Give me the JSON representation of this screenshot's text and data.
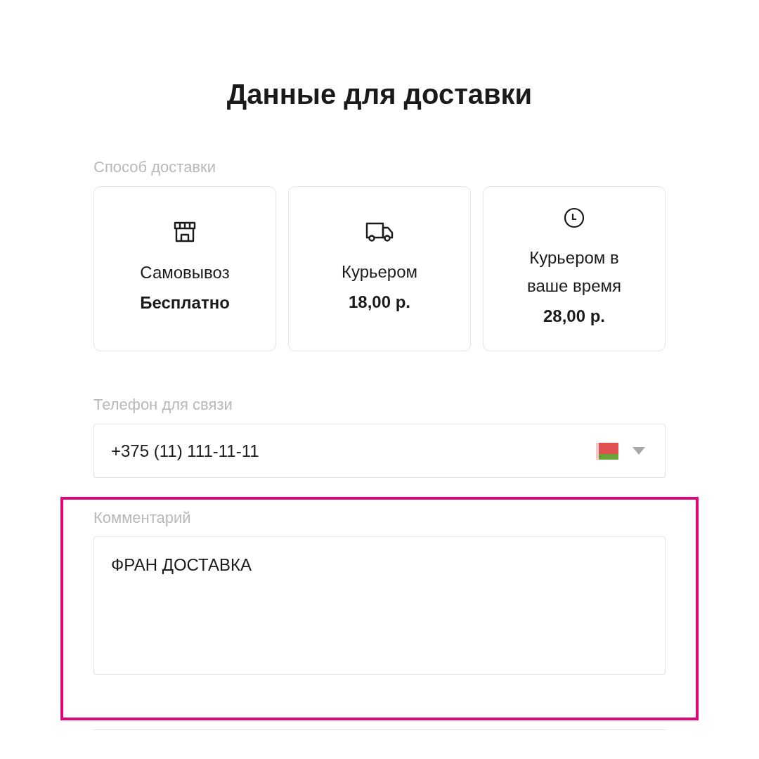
{
  "title": "Данные для доставки",
  "delivery": {
    "label": "Способ доставки",
    "options": [
      {
        "kind": "pickup",
        "name": "Самовывоз",
        "price": "Бесплатно"
      },
      {
        "kind": "courier",
        "name": "Курьером",
        "price": "18,00 р."
      },
      {
        "kind": "scheduled",
        "name": "Курьером в ваше время",
        "price": "28,00 р."
      }
    ]
  },
  "phone": {
    "label": "Телефон для связи",
    "value": "+375 (11) 111-11-11",
    "flag": {
      "kind": "belarus"
    }
  },
  "comment": {
    "label": "Комментарий",
    "value": "ФРАН ДОСТАВКА",
    "highlighted": true
  }
}
